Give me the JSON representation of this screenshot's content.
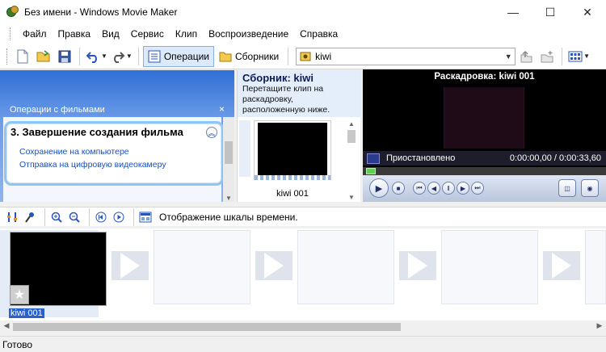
{
  "window": {
    "title": "Без имени - Windows Movie Maker",
    "controls": {
      "minimize": "—",
      "maximize": "☐",
      "close": "✕"
    }
  },
  "menu": {
    "items": [
      "Файл",
      "Правка",
      "Вид",
      "Сервис",
      "Клип",
      "Воспроизведение",
      "Справка"
    ]
  },
  "toolbar": {
    "operations_label": "Операции",
    "collections_label": "Сборники",
    "collection_combo_value": "kiwi"
  },
  "tasks": {
    "header": "Операции с фильмами",
    "close_glyph": "×",
    "section_title": "3. Завершение создания фильма",
    "collapse_glyph": "︽",
    "links": [
      "Сохранение на компьютере",
      "Отправка на цифровую видеокамеру"
    ]
  },
  "collection": {
    "title": "Сборник: kiwi",
    "description": "Перетащите клип на раскадровку, расположенную ниже.",
    "clip_label": "kiwi 001"
  },
  "monitor": {
    "title": "Раскадровка: kiwi 001",
    "status": "Приостановлено",
    "time": "0:00:00,00 / 0:00:33,60",
    "seek_position": 0.0
  },
  "timeline_bar": {
    "toggle_label": "Отображение шкалы времени."
  },
  "storyboard": {
    "clip_label": "kiwi 001"
  },
  "status_bar": {
    "text": "Готово"
  }
}
